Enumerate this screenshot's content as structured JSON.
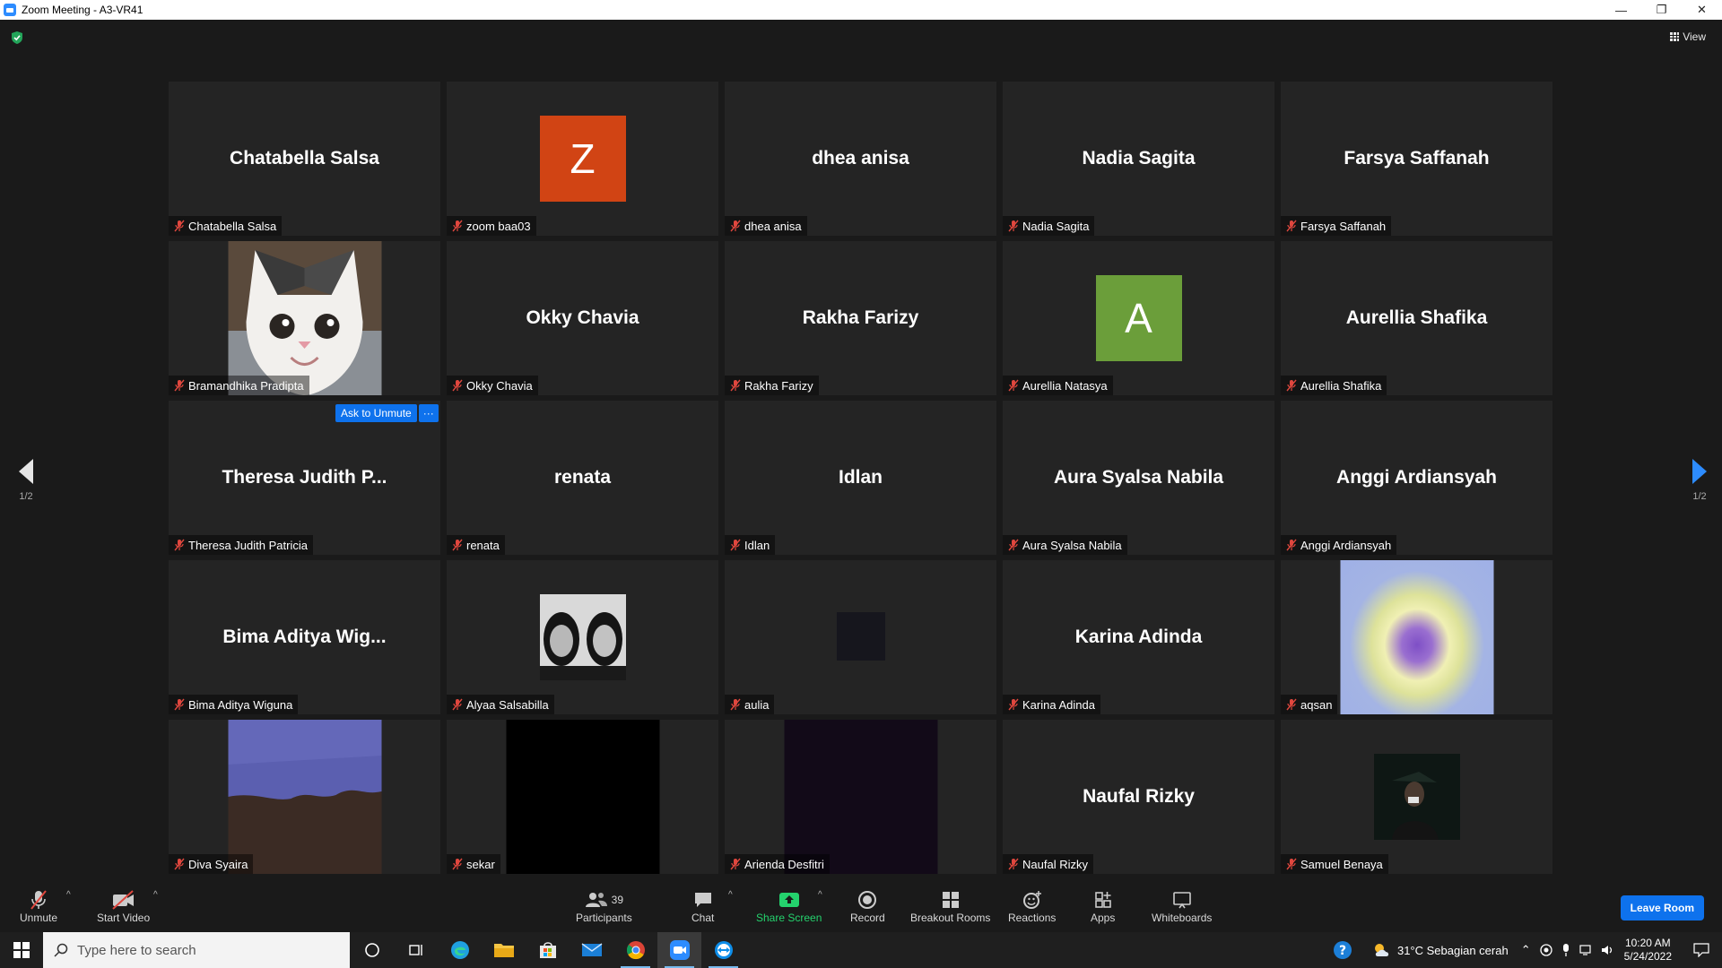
{
  "window": {
    "title": "Zoom Meeting - A3-VR41",
    "minimize": "—",
    "restore": "❐",
    "close": "✕"
  },
  "meeting": {
    "view_label": "View",
    "ask_unmute_label": "Ask to Unmute",
    "more_label": "···",
    "page_indicator": "1/2",
    "tiles": [
      {
        "display": "Chatabella Salsa",
        "label": "Chatabella Salsa",
        "kind": "name"
      },
      {
        "display": "Z",
        "label": "zoom baa03",
        "kind": "letter",
        "color": "#d14414"
      },
      {
        "display": "dhea anisa",
        "label": "dhea anisa",
        "kind": "name"
      },
      {
        "display": "Nadia Sagita",
        "label": "Nadia Sagita",
        "kind": "name"
      },
      {
        "display": "Farsya Saffanah",
        "label": "Farsya Saffanah",
        "kind": "name"
      },
      {
        "display": "",
        "label": "Bramandhika Pradipta",
        "kind": "cat"
      },
      {
        "display": "Okky Chavia",
        "label": "Okky Chavia",
        "kind": "name"
      },
      {
        "display": "Rakha Farizy",
        "label": "Rakha Farizy",
        "kind": "name"
      },
      {
        "display": "A",
        "label": "Aurellia Natasya",
        "kind": "letter",
        "color": "#6b9e3a"
      },
      {
        "display": "Aurellia Shafika",
        "label": "Aurellia Shafika",
        "kind": "name"
      },
      {
        "display": "Theresa Judith P...",
        "label": "Theresa Judith Patricia",
        "kind": "name"
      },
      {
        "display": "renata",
        "label": "renata",
        "kind": "name"
      },
      {
        "display": "Idlan",
        "label": "Idlan",
        "kind": "name"
      },
      {
        "display": "Aura Syalsa Nabila",
        "label": "Aura Syalsa Nabila",
        "kind": "name"
      },
      {
        "display": "Anggi Ardiansyah",
        "label": "Anggi Ardiansyah",
        "kind": "name"
      },
      {
        "display": "Bima Aditya Wig...",
        "label": "Bima Aditya Wiguna",
        "kind": "name"
      },
      {
        "display": "",
        "label": "Alyaa Salsabilla",
        "kind": "photo-bw"
      },
      {
        "display": "",
        "label": "aulia",
        "kind": "dark-square"
      },
      {
        "display": "Karina Adinda",
        "label": "Karina Adinda",
        "kind": "name"
      },
      {
        "display": "",
        "label": "aqsan",
        "kind": "heart"
      },
      {
        "display": "",
        "label": "Diva Syaira",
        "kind": "paper"
      },
      {
        "display": "",
        "label": "sekar",
        "kind": "black"
      },
      {
        "display": "",
        "label": "Arienda Desfitri",
        "kind": "darkpurple"
      },
      {
        "display": "Naufal Rizky",
        "label": "Naufal Rizky",
        "kind": "name"
      },
      {
        "display": "",
        "label": "Samuel Benaya",
        "kind": "person-dark"
      }
    ]
  },
  "toolbar": {
    "unmute": "Unmute",
    "start_video": "Start Video",
    "participants": "Participants",
    "participants_count": "39",
    "chat": "Chat",
    "share_screen": "Share Screen",
    "record": "Record",
    "breakout": "Breakout Rooms",
    "reactions": "Reactions",
    "apps": "Apps",
    "whiteboards": "Whiteboards",
    "leave": "Leave Room",
    "accent": "#0e72ed",
    "share_color": "#24d26d"
  },
  "taskbar": {
    "search_placeholder": "Type here to search",
    "weather": "31°C  Sebagian cerah",
    "time": "10:20 AM",
    "date": "5/24/2022"
  }
}
